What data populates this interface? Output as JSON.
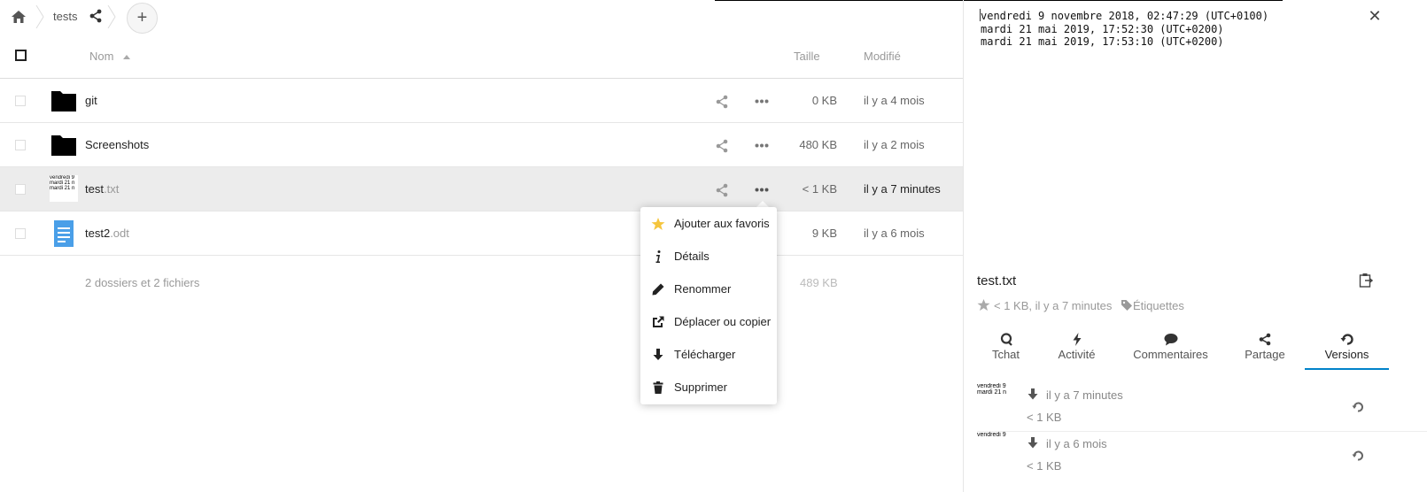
{
  "breadcrumb": {
    "folder": "tests"
  },
  "table": {
    "headers": {
      "name": "Nom",
      "size": "Taille",
      "modified": "Modifié"
    },
    "rows": [
      {
        "name": "git",
        "ext": "",
        "type": "folder",
        "size": "0 KB",
        "modified": "il y a 4 mois"
      },
      {
        "name": "Screenshots",
        "ext": "",
        "type": "folder",
        "size": "480 KB",
        "modified": "il y a 2 mois"
      },
      {
        "name": "test",
        "ext": ".txt",
        "type": "text",
        "size": "< 1 KB",
        "modified": "il y a 7 minutes",
        "thumb_lines": [
          "vendredi 9",
          "mardi 21 n",
          "mardi 21 n"
        ]
      },
      {
        "name": "test2",
        "ext": ".odt",
        "type": "document",
        "size": "9 KB",
        "modified": "il y a 6 mois"
      }
    ],
    "summary": "2 dossiers et 2 fichiers",
    "summary_size": "489 KB"
  },
  "menu": {
    "items": [
      {
        "label": "Ajouter aux favoris",
        "icon": "star-icon"
      },
      {
        "label": "Détails",
        "icon": "info-icon"
      },
      {
        "label": "Renommer",
        "icon": "pencil-icon"
      },
      {
        "label": "Déplacer ou copier",
        "icon": "external-icon"
      },
      {
        "label": "Télécharger",
        "icon": "download-icon"
      },
      {
        "label": "Supprimer",
        "icon": "trash-icon"
      }
    ]
  },
  "sidebar": {
    "preview_lines": [
      "vendredi 9 novembre 2018, 02:47:29 (UTC+0100)",
      "mardi 21 mai 2019, 17:52:30 (UTC+0200)",
      "mardi 21 mai 2019, 17:53:10 (UTC+0200)"
    ],
    "close": "✕",
    "title": "test.txt",
    "meta": "< 1 KB, il y a 7 minutes",
    "tags_label": "Étiquettes",
    "tabs": [
      {
        "label": "Tchat",
        "icon": "chat-bubble-icon"
      },
      {
        "label": "Activité",
        "icon": "lightning-icon"
      },
      {
        "label": "Commentaires",
        "icon": "comment-icon"
      },
      {
        "label": "Partage",
        "icon": "share-icon"
      },
      {
        "label": "Versions",
        "icon": "history-icon",
        "active": true
      }
    ],
    "versions": [
      {
        "thumb_lines": [
          "vendredi 9",
          "mardi 21 n"
        ],
        "time": "il y a 7 minutes",
        "size": "< 1 KB"
      },
      {
        "thumb_lines": [
          "vendredi 9"
        ],
        "time": "il y a 6 mois",
        "size": "< 1 KB"
      }
    ]
  },
  "colors": {
    "accent": "#0082c9",
    "folder": "#000000",
    "document": "#4a9fe8",
    "star": "#f5c53d"
  }
}
